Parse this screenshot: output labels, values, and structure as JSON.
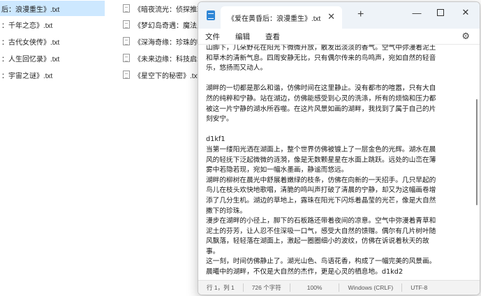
{
  "explorer": {
    "left_column": [
      {
        "name": "后：浪漫重生》.txt",
        "selected": true
      },
      {
        "name": "：千年之恋》.txt"
      },
      {
        "name": "：古代女侠传》.txt"
      },
      {
        "name": "：人生回忆录》.txt"
      },
      {
        "name": "：宇宙之谜》.txt"
      }
    ],
    "right_column": [
      {
        "name": "《暗夜流光：侦探推理录"
      },
      {
        "name": "《梦幻岛奇遇：魔法之旅"
      },
      {
        "name": "《深海奇缘：珍珠的呼唤"
      },
      {
        "name": "《未来边缘：科技启示录"
      },
      {
        "name": "《星空下的秘密》.txt"
      }
    ]
  },
  "notepad": {
    "tab_title": "《爱在黄昏后：浪漫重生》.txt",
    "close_tab_glyph": "✕",
    "new_tab_glyph": "+",
    "minimize_glyph": "—",
    "close_glyph": "✕",
    "menu": [
      "文件",
      "编辑",
      "查看"
    ],
    "settings_glyph": "⚙",
    "lines": [
      "山脚下，几朵野花在阳光下微微开放，散发出淡淡的香气。空气中弥漫着泥土",
      "和草木的清新气息。四周安静无比，只有偶尔传来的鸟鸣声，宛如自然的轻音",
      "乐，悠扬而又动人。",
      "",
      "湖畔的一切都是那么和谐，仿佛时间在这里静止。没有都市的喧嚣，只有大自",
      "然的纯粹和宁静。站在湖边，仿佛能感受到心灵的洗涤，所有的烦恼和压力都",
      "被这一片宁静的湖水所吞噬。在这片风景如画的湖畔，我找到了属于自己的片",
      "刻安宁。",
      "",
      "d1kf1",
      "当第一缕阳光洒在湖面上，整个世界仿佛被镀上了一层金色的光辉。湖水在晨",
      "风的轻抚下泛起微微的涟漪，像是无数颗星星在水面上跳跃。远处的山峦在薄",
      "雾中若隐若现，宛如一幅水墨画，静谧而悠远。",
      "湖畔的柳树在晨光中舒展着嫩绿的枝条，仿佛在向新的一天招手。几只早起的",
      "鸟儿在枝头欢快地歌唱，清脆的鸣叫声打破了清晨的宁静，却又为这幅画卷增",
      "添了几分生机。湖边的草地上，露珠在阳光下闪烁着晶莹的光芒，像是大自然",
      "撒下的珍珠。",
      "漫步在湖畔的小径上，脚下的石板路还带着夜间的凉意。空气中弥漫着青草和",
      "泥土的芬芳，让人忍不住深吸一口气，感受大自然的馈赠。偶尔有几片树叶随",
      "风飘落，轻轻落在湖面上，激起一圈圈细小的波纹，仿佛在诉说着秋天的故",
      "事。",
      "这一刻，时间仿佛静止了。湖光山色、鸟语花香，构成了一幅完美的风景画。",
      "晨曦中的湖畔，不仅是大自然的杰作，更是心灵的栖息地。d1kd2"
    ],
    "status": {
      "position": "行 1，列 1",
      "chars": "726 个字符",
      "zoom": "100%",
      "eol": "Windows (CRLF)",
      "encoding": "UTF-8"
    }
  }
}
